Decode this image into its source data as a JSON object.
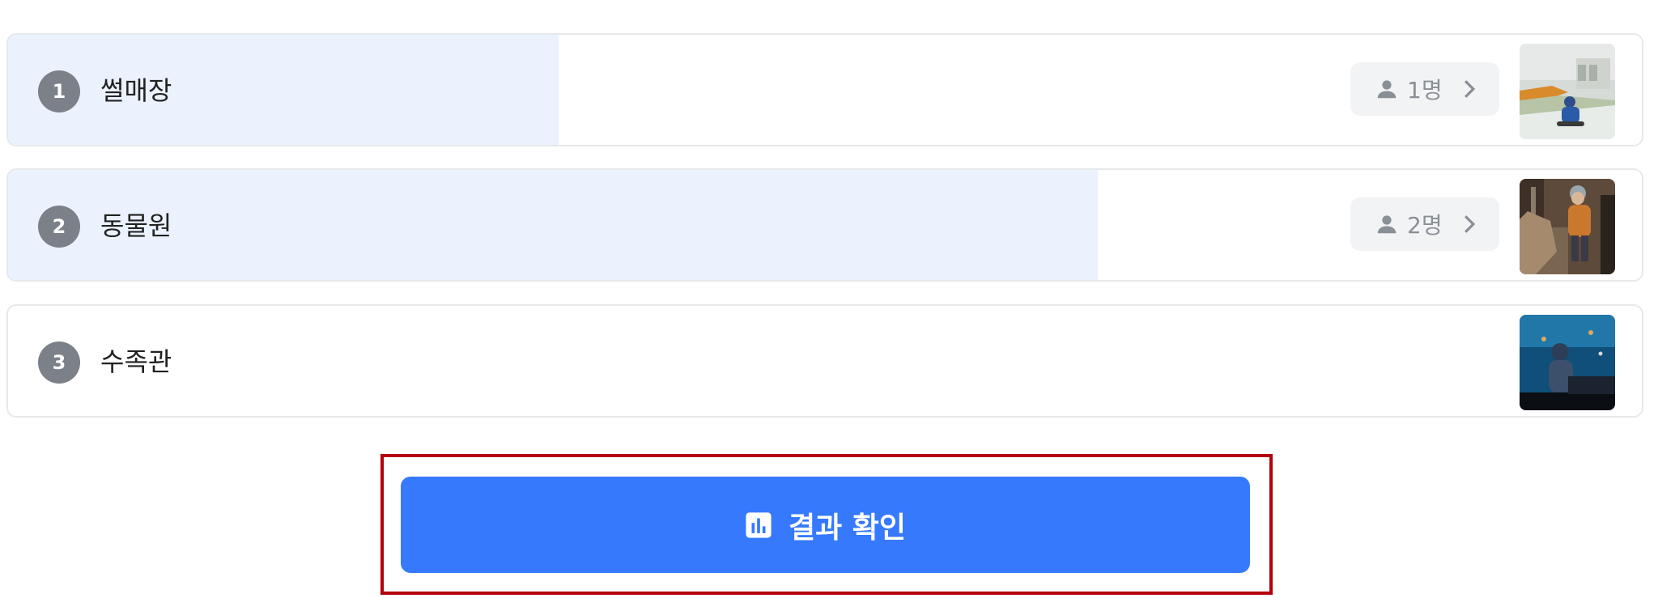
{
  "options": [
    {
      "rank": "1",
      "label": "썰매장",
      "vote_share": 0.337,
      "voters": "1명",
      "thumb_icon": "sledding-photo"
    },
    {
      "rank": "2",
      "label": "동물원",
      "vote_share": 0.667,
      "voters": "2명",
      "thumb_icon": "zoo-photo"
    },
    {
      "rank": "3",
      "label": "수족관",
      "vote_share": 0,
      "thumb_icon": "aquarium-photo"
    }
  ],
  "result_button": {
    "label": "결과 확인",
    "icon": "bar-chart-icon"
  },
  "colors": {
    "accent": "#3679fd",
    "fill": "#ebf2fe",
    "rank_badge": "#7b8089",
    "highlight": "#b3000b"
  }
}
